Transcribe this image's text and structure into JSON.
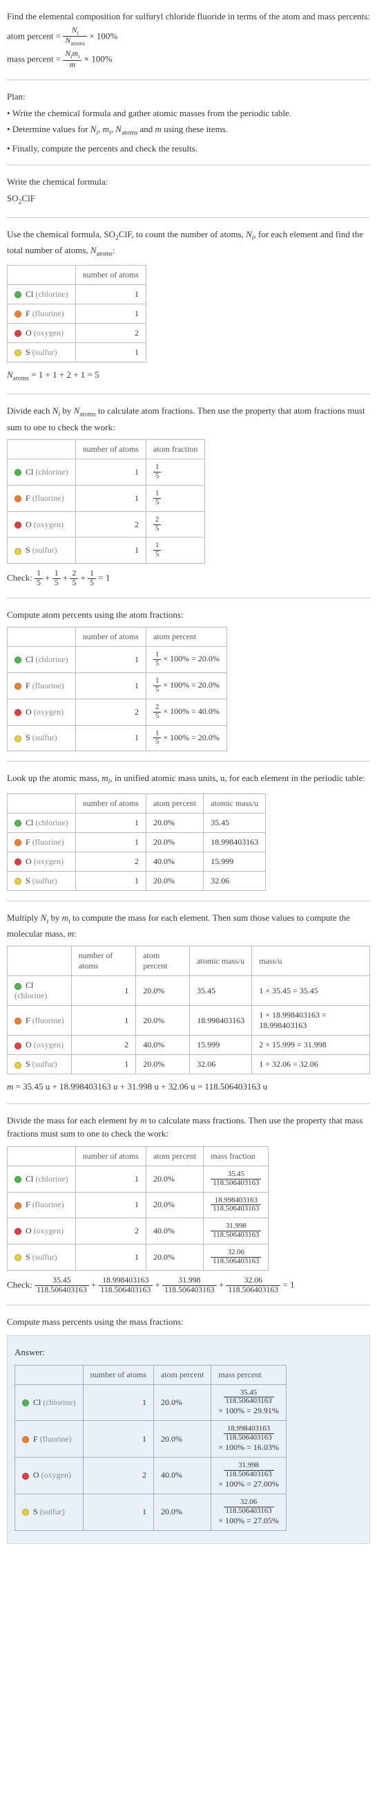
{
  "intro": {
    "title": "Find the elemental composition for sulfuryl chloride fluoride in terms of the atom and mass percents:",
    "atom_percent_label": "atom percent",
    "mass_percent_label": "mass percent",
    "times100": "× 100%"
  },
  "plan": {
    "heading": "Plan:",
    "b1": "• Write the chemical formula and gather atomic masses from the periodic table.",
    "b2_prefix": "• Determine values for ",
    "b2_suffix": " using these items.",
    "b3": "• Finally, compute the percents and check the results."
  },
  "write_formula": {
    "heading": "Write the chemical formula:",
    "formula_plain": "SO",
    "formula_sub": "2",
    "formula_tail": "ClF"
  },
  "count_atoms": {
    "text_a": "Use the chemical formula, SO",
    "text_b": "ClF, to count the number of atoms, ",
    "text_c": ", for each element and find the total number of atoms, ",
    "text_d": ":",
    "header_atoms": "number of atoms",
    "rows": [
      {
        "dot": "dot-cl",
        "el": "Cl",
        "name": "(chlorine)",
        "n": "1"
      },
      {
        "dot": "dot-f",
        "el": "F",
        "name": "(fluorine)",
        "n": "1"
      },
      {
        "dot": "dot-o",
        "el": "O",
        "name": "(oxygen)",
        "n": "2"
      },
      {
        "dot": "dot-s",
        "el": "S",
        "name": "(sulfur)",
        "n": "1"
      }
    ],
    "n_atoms_eq": " = 1 + 1 + 2 + 1 = 5"
  },
  "atom_fractions": {
    "text": "Divide each Nᵢ by N_atoms to calculate atom fractions. Then use the property that atom fractions must sum to one to check the work:",
    "text_plain_a": "Divide each ",
    "text_plain_b": " by ",
    "text_plain_c": " to calculate atom fractions. Then use the property that atom fractions must sum to one to check the work:",
    "header_atoms": "number of atoms",
    "header_frac": "atom fraction",
    "rows": [
      {
        "dot": "dot-cl",
        "el": "Cl",
        "name": "(chlorine)",
        "n": "1",
        "num": "1",
        "den": "5"
      },
      {
        "dot": "dot-f",
        "el": "F",
        "name": "(fluorine)",
        "n": "1",
        "num": "1",
        "den": "5"
      },
      {
        "dot": "dot-o",
        "el": "O",
        "name": "(oxygen)",
        "n": "2",
        "num": "2",
        "den": "5"
      },
      {
        "dot": "dot-s",
        "el": "S",
        "name": "(sulfur)",
        "n": "1",
        "num": "1",
        "den": "5"
      }
    ],
    "check_label": "Check:",
    "check_eq": " = 1"
  },
  "atom_percents": {
    "text": "Compute atom percents using the atom fractions:",
    "header_atoms": "number of atoms",
    "header_pct": "atom percent",
    "rows": [
      {
        "dot": "dot-cl",
        "el": "Cl",
        "name": "(chlorine)",
        "n": "1",
        "num": "1",
        "den": "5",
        "pct": "× 100% = 20.0%"
      },
      {
        "dot": "dot-f",
        "el": "F",
        "name": "(fluorine)",
        "n": "1",
        "num": "1",
        "den": "5",
        "pct": "× 100% = 20.0%"
      },
      {
        "dot": "dot-o",
        "el": "O",
        "name": "(oxygen)",
        "n": "2",
        "num": "2",
        "den": "5",
        "pct": "× 100% = 40.0%"
      },
      {
        "dot": "dot-s",
        "el": "S",
        "name": "(sulfur)",
        "n": "1",
        "num": "1",
        "den": "5",
        "pct": "× 100% = 20.0%"
      }
    ]
  },
  "atomic_mass": {
    "text_a": "Look up the atomic mass, ",
    "text_b": ", in unified atomic mass units, u, for each element in the periodic table:",
    "header_atoms": "number of atoms",
    "header_pct": "atom percent",
    "header_mass": "atomic mass/u",
    "rows": [
      {
        "dot": "dot-cl",
        "el": "Cl",
        "name": "(chlorine)",
        "n": "1",
        "pct": "20.0%",
        "mass": "35.45"
      },
      {
        "dot": "dot-f",
        "el": "F",
        "name": "(fluorine)",
        "n": "1",
        "pct": "20.0%",
        "mass": "18.998403163"
      },
      {
        "dot": "dot-o",
        "el": "O",
        "name": "(oxygen)",
        "n": "2",
        "pct": "40.0%",
        "mass": "15.999"
      },
      {
        "dot": "dot-s",
        "el": "S",
        "name": "(sulfur)",
        "n": "1",
        "pct": "20.0%",
        "mass": "32.06"
      }
    ]
  },
  "mol_mass": {
    "text_a": "Multiply ",
    "text_b": " by ",
    "text_c": " to compute the mass for each element. Then sum those values to compute the molecular mass, ",
    "text_d": ":",
    "header_atoms": "number of atoms",
    "header_pct": "atom percent",
    "header_amass": "atomic mass/u",
    "header_mass": "mass/u",
    "rows": [
      {
        "dot": "dot-cl",
        "el": "Cl",
        "name": "(chlorine)",
        "n": "1",
        "pct": "20.0%",
        "amass": "35.45",
        "mass": "1 × 35.45 = 35.45"
      },
      {
        "dot": "dot-f",
        "el": "F",
        "name": "(fluorine)",
        "n": "1",
        "pct": "20.0%",
        "amass": "18.998403163",
        "mass": "1 × 18.998403163 = 18.998403163"
      },
      {
        "dot": "dot-o",
        "el": "O",
        "name": "(oxygen)",
        "n": "2",
        "pct": "40.0%",
        "amass": "15.999",
        "mass": "2 × 15.999 = 31.998"
      },
      {
        "dot": "dot-s",
        "el": "S",
        "name": "(sulfur)",
        "n": "1",
        "pct": "20.0%",
        "amass": "32.06",
        "mass": "1 × 32.06 = 32.06"
      }
    ],
    "m_eq": " = 35.45 u + 18.998403163 u + 31.998 u + 32.06 u = 118.506403163 u"
  },
  "mass_fractions": {
    "text_a": "Divide the mass for each element by ",
    "text_b": " to calculate mass fractions. Then use the property that mass fractions must sum to one to check the work:",
    "header_atoms": "number of atoms",
    "header_pct": "atom percent",
    "header_mf": "mass fraction",
    "rows": [
      {
        "dot": "dot-cl",
        "el": "Cl",
        "name": "(chlorine)",
        "n": "1",
        "pct": "20.0%",
        "num": "35.45",
        "den": "118.506403163"
      },
      {
        "dot": "dot-f",
        "el": "F",
        "name": "(fluorine)",
        "n": "1",
        "pct": "20.0%",
        "num": "18.998403163",
        "den": "118.506403163"
      },
      {
        "dot": "dot-o",
        "el": "O",
        "name": "(oxygen)",
        "n": "2",
        "pct": "40.0%",
        "num": "31.998",
        "den": "118.506403163"
      },
      {
        "dot": "dot-s",
        "el": "S",
        "name": "(sulfur)",
        "n": "1",
        "pct": "20.0%",
        "num": "32.06",
        "den": "118.506403163"
      }
    ],
    "check_label": "Check:",
    "check_terms": [
      {
        "num": "35.45",
        "den": "118.506403163"
      },
      {
        "num": "18.998403163",
        "den": "118.506403163"
      },
      {
        "num": "31.998",
        "den": "118.506403163"
      },
      {
        "num": "32.06",
        "den": "118.506403163"
      }
    ],
    "check_result": " = 1"
  },
  "mass_percents": {
    "text": "Compute mass percents using the mass fractions:"
  },
  "answer": {
    "label": "Answer:",
    "header_atoms": "number of atoms",
    "header_pct": "atom percent",
    "header_mp": "mass percent",
    "rows": [
      {
        "dot": "dot-cl",
        "el": "Cl",
        "name": "(chlorine)",
        "n": "1",
        "pct": "20.0%",
        "num": "35.45",
        "den": "118.506403163",
        "res": "× 100% = 29.91%"
      },
      {
        "dot": "dot-f",
        "el": "F",
        "name": "(fluorine)",
        "n": "1",
        "pct": "20.0%",
        "num": "18.998403163",
        "den": "118.506403163",
        "res": "× 100% = 16.03%"
      },
      {
        "dot": "dot-o",
        "el": "O",
        "name": "(oxygen)",
        "n": "2",
        "pct": "40.0%",
        "num": "31.998",
        "den": "118.506403163",
        "res": "× 100% = 27.00%"
      },
      {
        "dot": "dot-s",
        "el": "S",
        "name": "(sulfur)",
        "n": "1",
        "pct": "20.0%",
        "num": "32.06",
        "den": "118.506403163",
        "res": "× 100% = 27.05%"
      }
    ]
  },
  "chart_data": {
    "type": "table",
    "title": "Elemental composition of sulfuryl chloride fluoride (SO2ClF)",
    "elements": [
      {
        "symbol": "Cl",
        "name": "chlorine",
        "atoms": 1,
        "atom_fraction": 0.2,
        "atom_percent": 20.0,
        "atomic_mass_u": 35.45,
        "mass_u": 35.45,
        "mass_fraction": 0.2992,
        "mass_percent": 29.91
      },
      {
        "symbol": "F",
        "name": "fluorine",
        "atoms": 1,
        "atom_fraction": 0.2,
        "atom_percent": 20.0,
        "atomic_mass_u": 18.998403163,
        "mass_u": 18.998403163,
        "mass_fraction": 0.1603,
        "mass_percent": 16.03
      },
      {
        "symbol": "O",
        "name": "oxygen",
        "atoms": 2,
        "atom_fraction": 0.4,
        "atom_percent": 40.0,
        "atomic_mass_u": 15.999,
        "mass_u": 31.998,
        "mass_fraction": 0.27,
        "mass_percent": 27.0
      },
      {
        "symbol": "S",
        "name": "sulfur",
        "atoms": 1,
        "atom_fraction": 0.2,
        "atom_percent": 20.0,
        "atomic_mass_u": 32.06,
        "mass_u": 32.06,
        "mass_fraction": 0.2705,
        "mass_percent": 27.05
      }
    ],
    "N_atoms": 5,
    "molecular_mass_u": 118.506403163
  }
}
